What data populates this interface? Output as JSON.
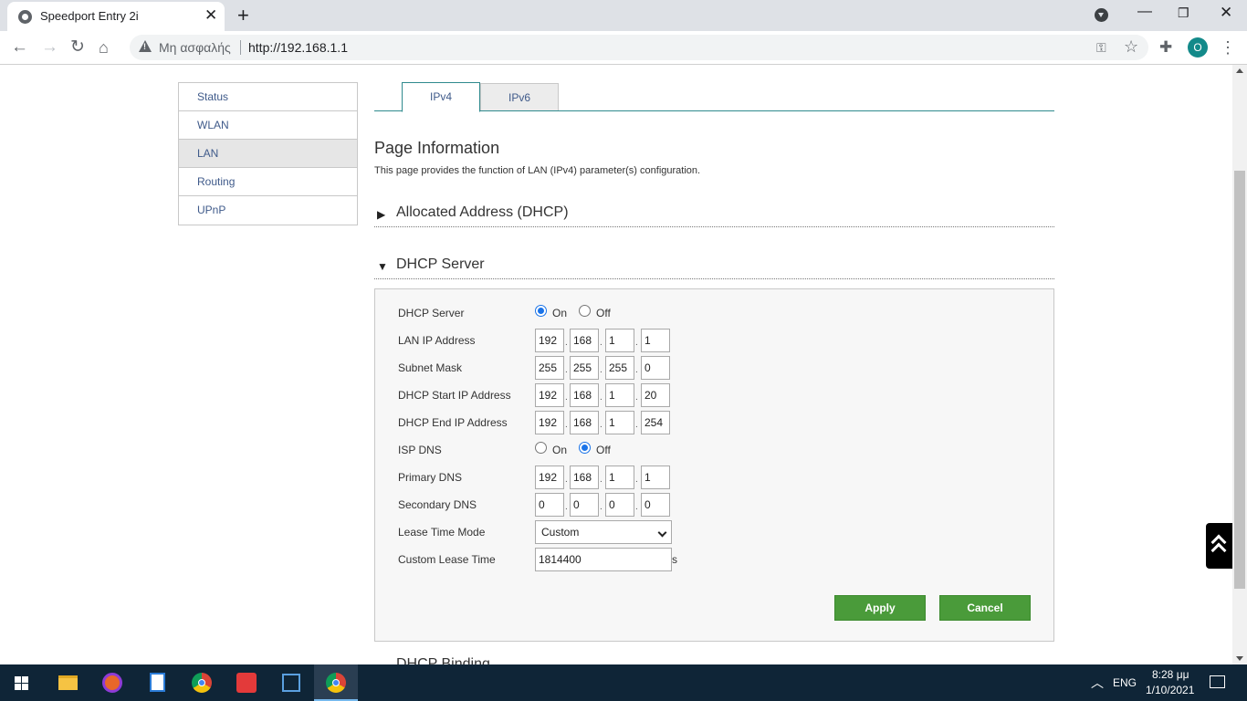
{
  "browser": {
    "tab_title": "Speedport Entry 2i",
    "security_text": "Μη ασφαλής",
    "url": "http://192.168.1.1",
    "profile_initial": "O"
  },
  "sidebar": {
    "items": [
      {
        "label": "Status",
        "active": false
      },
      {
        "label": "WLAN",
        "active": false
      },
      {
        "label": "LAN",
        "active": true
      },
      {
        "label": "Routing",
        "active": false
      },
      {
        "label": "UPnP",
        "active": false
      }
    ]
  },
  "tabs": [
    {
      "label": "IPv4",
      "active": true
    },
    {
      "label": "IPv6",
      "active": false
    }
  ],
  "page": {
    "title": "Page Information",
    "description": "This page provides the function of LAN (IPv4) parameter(s) configuration."
  },
  "sections": {
    "allocated": "Allocated Address (DHCP)",
    "dhcp_server": "DHCP Server",
    "dhcp_binding": "DHCP Binding"
  },
  "form": {
    "dhcp_server": {
      "label": "DHCP Server",
      "on": "On",
      "off": "Off",
      "selected": "on"
    },
    "lan_ip": {
      "label": "LAN IP Address",
      "octets": [
        "192",
        "168",
        "1",
        "1"
      ]
    },
    "subnet_mask": {
      "label": "Subnet Mask",
      "octets": [
        "255",
        "255",
        "255",
        "0"
      ]
    },
    "dhcp_start": {
      "label": "DHCP Start IP Address",
      "octets": [
        "192",
        "168",
        "1",
        "20"
      ]
    },
    "dhcp_end": {
      "label": "DHCP End IP Address",
      "octets": [
        "192",
        "168",
        "1",
        "254"
      ]
    },
    "isp_dns": {
      "label": "ISP DNS",
      "on": "On",
      "off": "Off",
      "selected": "off"
    },
    "primary_dns": {
      "label": "Primary DNS",
      "octets": [
        "192",
        "168",
        "1",
        "1"
      ]
    },
    "secondary_dns": {
      "label": "Secondary DNS",
      "octets": [
        "0",
        "0",
        "0",
        "0"
      ]
    },
    "lease_mode": {
      "label": "Lease Time Mode",
      "value": "Custom"
    },
    "custom_lease": {
      "label": "Custom Lease Time",
      "value": "1814400",
      "unit": "s"
    },
    "apply_label": "Apply",
    "cancel_label": "Cancel"
  },
  "taskbar": {
    "language": "ENG",
    "time": "8:28 μμ",
    "date": "1/10/2021"
  },
  "colors": {
    "accent_teal": "#2f8a8e",
    "button_green": "#4a9b3a",
    "link_blue": "#3f5a8a"
  }
}
